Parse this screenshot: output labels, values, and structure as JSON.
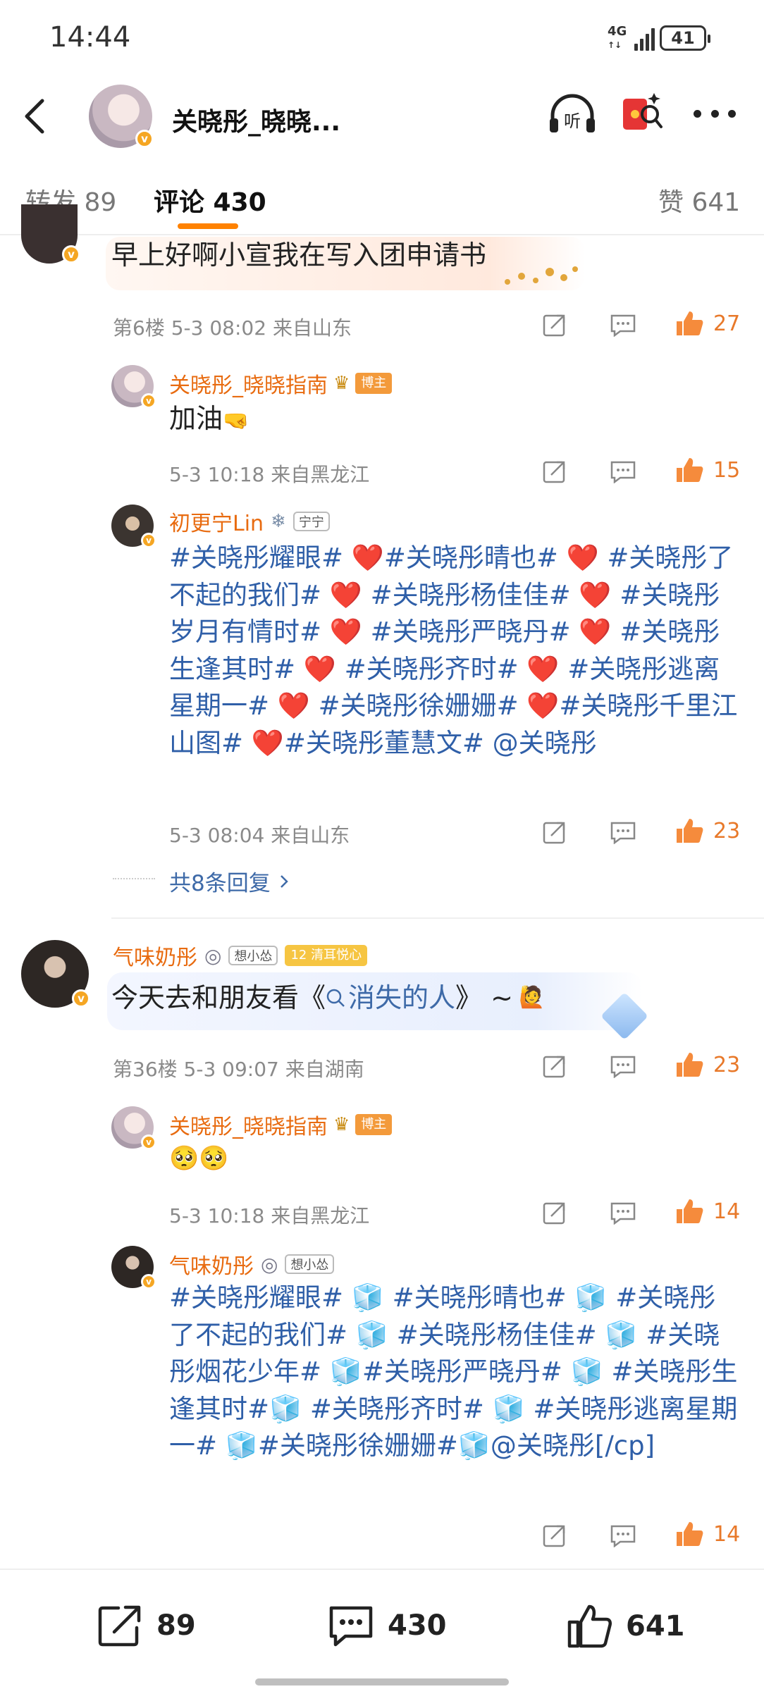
{
  "status": {
    "time": "14:44",
    "network": "4G",
    "battery": "41"
  },
  "header": {
    "title": "关晓彤_晓晓...",
    "listen_label": "听"
  },
  "tabs": {
    "repost": "转发 89",
    "comment": "评论 430",
    "like": "赞 641"
  },
  "comment6": {
    "text": "早上好啊小宣我在写入团申请书",
    "meta": "第6楼 5-3 08:02 来自山东",
    "likes": "27",
    "replies": [
      {
        "name": "关晓彤_晓晓指南",
        "badge": "博主",
        "text": "加油",
        "meta": "5-3 10:18 来自黑龙江",
        "likes": "15"
      },
      {
        "name": "初更宁Lin",
        "badge": "宁宁",
        "text": "#关晓彤耀眼# ❤️#关晓彤晴也# ❤️ #关晓彤了不起的我们# ❤️ #关晓彤杨佳佳# ❤️ #关晓彤岁月有情时# ❤️ #关晓彤严晓丹# ❤️ #关晓彤生逢其时# ❤️ #关晓彤齐时# ❤️ #关晓彤逃离星期一# ❤️ #关晓彤徐姗姗# ❤️#关晓彤千里江山图# ❤️#关晓彤董慧文# @关晓彤",
        "meta": "5-3 08:04 来自山东",
        "likes": "23"
      }
    ],
    "more_replies": "共8条回复"
  },
  "comment36": {
    "name": "气味奶彤",
    "badge1": "想小怂",
    "badge2_level": "12",
    "badge2": "清耳悦心",
    "text_before": "今天去和朋友看《",
    "link": "消失的人",
    "text_after": "》 ~",
    "meta": "第36楼 5-3 09:07 来自湖南",
    "likes": "23",
    "replies": [
      {
        "name": "关晓彤_晓晓指南",
        "badge": "博主",
        "meta": "5-3 10:18 来自黑龙江",
        "likes": "14"
      },
      {
        "name": "气味奶彤",
        "badge": "想小怂",
        "text": "#关晓彤耀眼# 🧊 #关晓彤晴也# 🧊 #关晓彤了不起的我们# 🧊 #关晓彤杨佳佳# 🧊 #关晓彤烟花少年# 🧊#关晓彤严晓丹# 🧊 #关晓彤生逢其时#🧊 #关晓彤齐时# 🧊 #关晓彤逃离星期一# 🧊#关晓彤徐姗姗#🧊@关晓彤[/cp]",
        "likes": "14"
      }
    ]
  },
  "bottom": {
    "repost": "89",
    "comment": "430",
    "like": "641"
  }
}
